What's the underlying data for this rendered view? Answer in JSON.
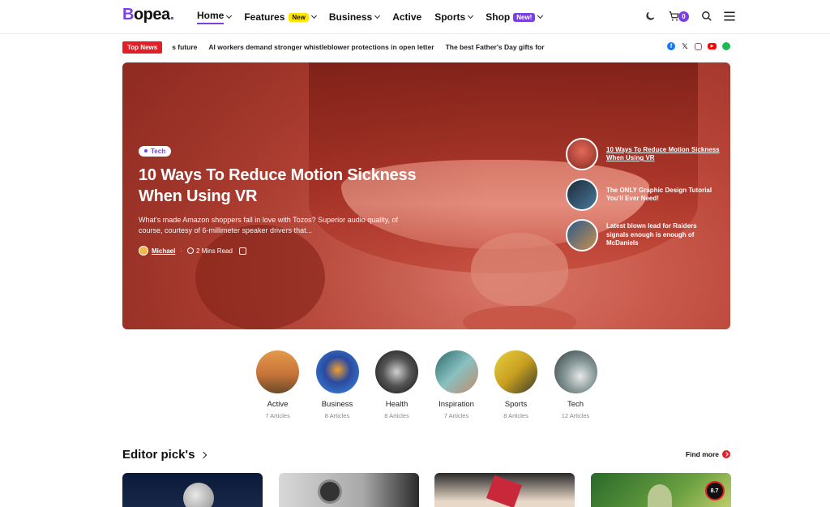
{
  "header": {
    "logo_text": "Bopea",
    "logo_first": "B",
    "logo_rest": "opea",
    "logo_dot": ".",
    "nav": [
      {
        "label": "Home",
        "badge": ""
      },
      {
        "label": "Features",
        "badge": "New"
      },
      {
        "label": "Business",
        "badge": ""
      },
      {
        "label": "Active",
        "badge": ""
      },
      {
        "label": "Sports",
        "badge": ""
      },
      {
        "label": "Shop",
        "badge": "New!"
      }
    ],
    "cart_count": "0",
    "accent": "#7b3fe4"
  },
  "ticker": {
    "label": "Top News",
    "items": [
      "s future",
      "AI workers demand stronger whistleblower protections in open letter",
      "The best Father's Day gifts for"
    ]
  },
  "hero": {
    "tag": "Tech",
    "title": "10 Ways To Reduce Motion Sickness When Using VR",
    "excerpt": "What's made Amazon shoppers fall in love with Tozos? Superior audio quality, of course, courtesy of 6-millimeter speaker drivers that...",
    "author": "Michael",
    "read_time": "2 Mins Read",
    "side": [
      {
        "title": "10 Ways To Reduce Motion Sickness When Using VR"
      },
      {
        "title": "The ONLY Graphic Design Tutorial You'll Ever Need!"
      },
      {
        "title": "Latest blown lead for Raiders signals enough is enough of McDaniels"
      }
    ]
  },
  "categories": [
    {
      "name": "Active",
      "count": "7 Articles"
    },
    {
      "name": "Business",
      "count": "8 Articles"
    },
    {
      "name": "Health",
      "count": "8 Articles"
    },
    {
      "name": "Inspiration",
      "count": "7 Articles"
    },
    {
      "name": "Sports",
      "count": "8 Articles"
    },
    {
      "name": "Tech",
      "count": "12 Articles"
    }
  ],
  "editor": {
    "title": "Editor pick's",
    "find_more": "Find more",
    "score": "8.7"
  }
}
